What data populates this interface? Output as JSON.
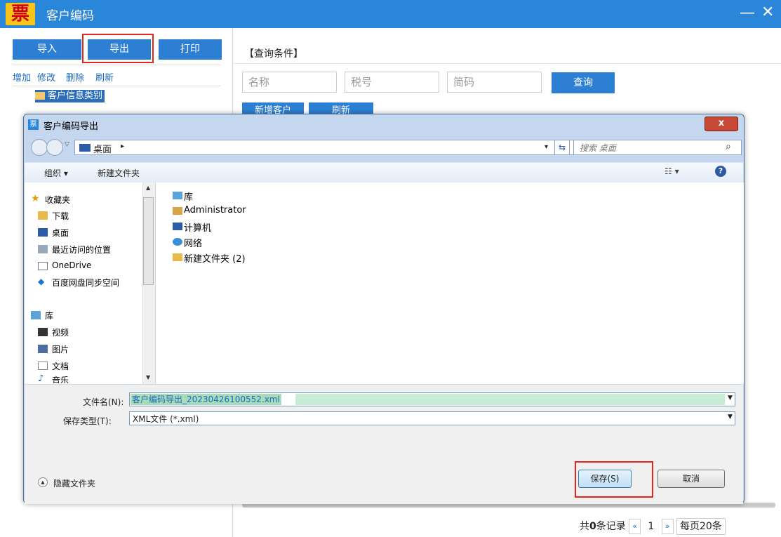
{
  "app": {
    "title": "客户编码",
    "logo_text": "票",
    "min_glyph": "—",
    "close_glyph": "✕",
    "toolbar": {
      "import": "导入",
      "export": "导出",
      "print": "打印"
    },
    "actions": {
      "add": "增加",
      "edit": "修改",
      "delete": "删除",
      "refresh": "刷新"
    },
    "tree_item": "客户信息类别",
    "query": {
      "title": "【查询条件】",
      "name_placeholder": "名称",
      "tax_placeholder": "税号",
      "code_placeholder": "简码",
      "button": "查询"
    },
    "behind_buttons": {
      "a": "新增客户",
      "b": "刷新"
    },
    "pager": {
      "total_prefix": "共",
      "total_count": "0",
      "total_suffix": "条记录",
      "prev": "«",
      "page": "1",
      "next": "»",
      "page_size": "每页20条"
    }
  },
  "dialog": {
    "title": "客户编码导出",
    "close_glyph": "x",
    "address": {
      "location": "桌面",
      "arrow": "▸",
      "search_placeholder": "搜索 桌面"
    },
    "commands": {
      "organize": "组织 ▾",
      "new_folder": "新建文件夹",
      "view": "☷ ▾",
      "help": "?"
    },
    "nav_items": [
      "收藏夹",
      "下载",
      "桌面",
      "最近访问的位置",
      "OneDrive",
      "百度网盘同步空间",
      "库",
      "视频",
      "图片",
      "文档",
      "音乐"
    ],
    "files": [
      "库",
      "Administrator",
      "计算机",
      "网络",
      "新建文件夹 (2)"
    ],
    "filename_label": "文件名(N):",
    "filename_value": "客户编码导出_20230426100552.xml",
    "filetype_label": "保存类型(T):",
    "filetype_value": "XML文件 (*.xml)",
    "hide_folders": "隐藏文件夹",
    "save": "保存(S)",
    "cancel": "取消"
  },
  "colors": {
    "accent": "#2a86d8",
    "highlight": "#e0281f",
    "selection": "#2d6db8"
  }
}
